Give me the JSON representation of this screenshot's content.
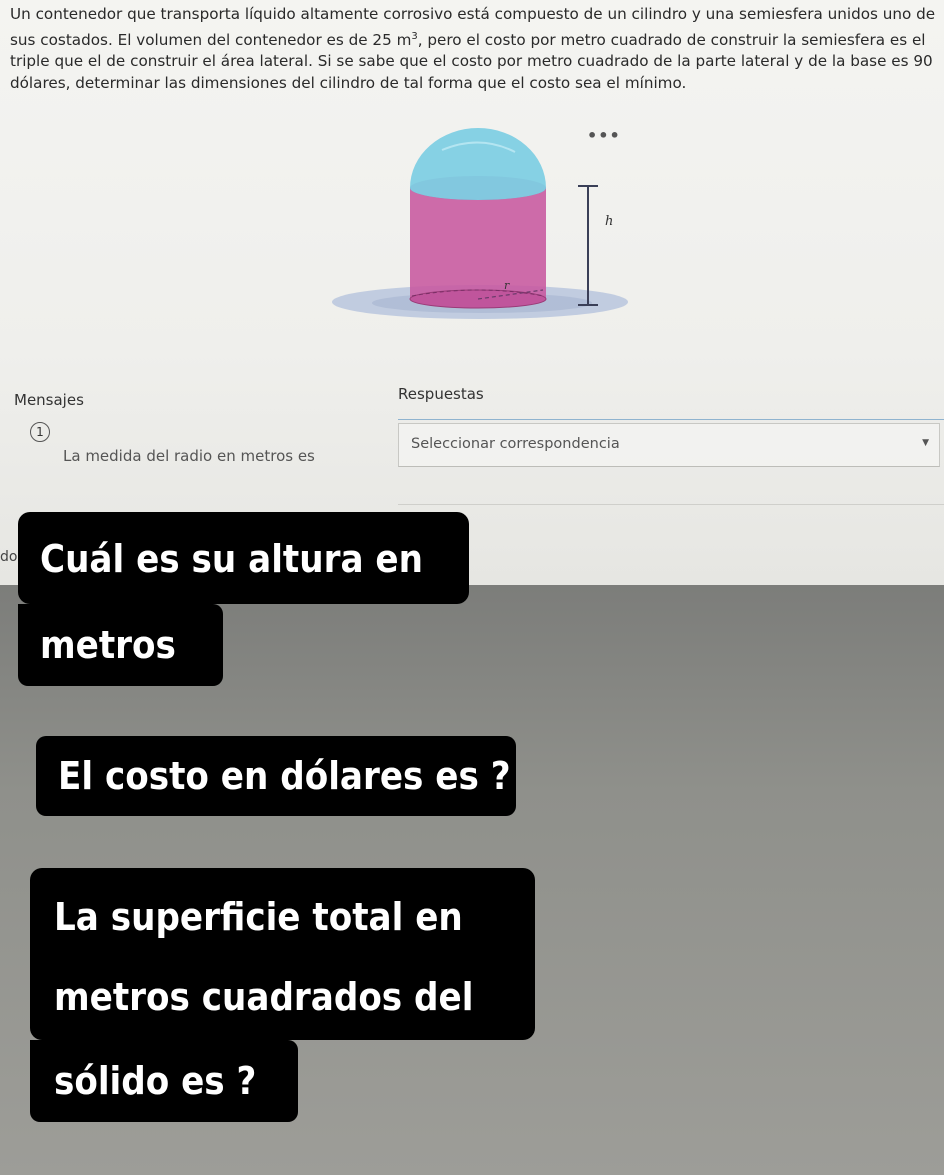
{
  "problem": {
    "line1": "Un contenedor que transporta líquido altamente corrosivo está compuesto de un cilindro y una semiesfera unidos uno de",
    "line2_a": "sus costados. El volumen del contenedor es de 25 m",
    "line2_sup": "3",
    "line2_b": ", pero el costo por metro cuadrado de construir la semiesfera es el",
    "line3": "triple que el de construir el área lateral. Si se sabe que el costo por metro cuadrado de la parte lateral y de la base es 90",
    "line4": "dólares, determinar las dimensiones del cilindro de tal forma que el costo sea el mínimo."
  },
  "figure": {
    "more_icon": "•••",
    "height_label": "h",
    "radius_label": "r",
    "colors": {
      "hemisphere": "#7fcfe3",
      "cylinder": "#c7589f",
      "base_plane": "#b9c6dd"
    }
  },
  "columns": {
    "messages": "Mensajes",
    "answers": "Respuestas"
  },
  "question": {
    "number": "1",
    "text": "La medida del radio en metros es",
    "select_placeholder": "Seleccionar correspondencia",
    "caret_icon": "caret-down-icon"
  },
  "edge_fragment": "do",
  "overlay": {
    "q1_line1": "Cuál es su altura en",
    "q1_line2": "metros",
    "q2": "El costo en dólares es ?",
    "q3_line1": "La superficie total en",
    "q3_line2": "metros cuadrados del",
    "q3_line3": "sólido es ?"
  }
}
